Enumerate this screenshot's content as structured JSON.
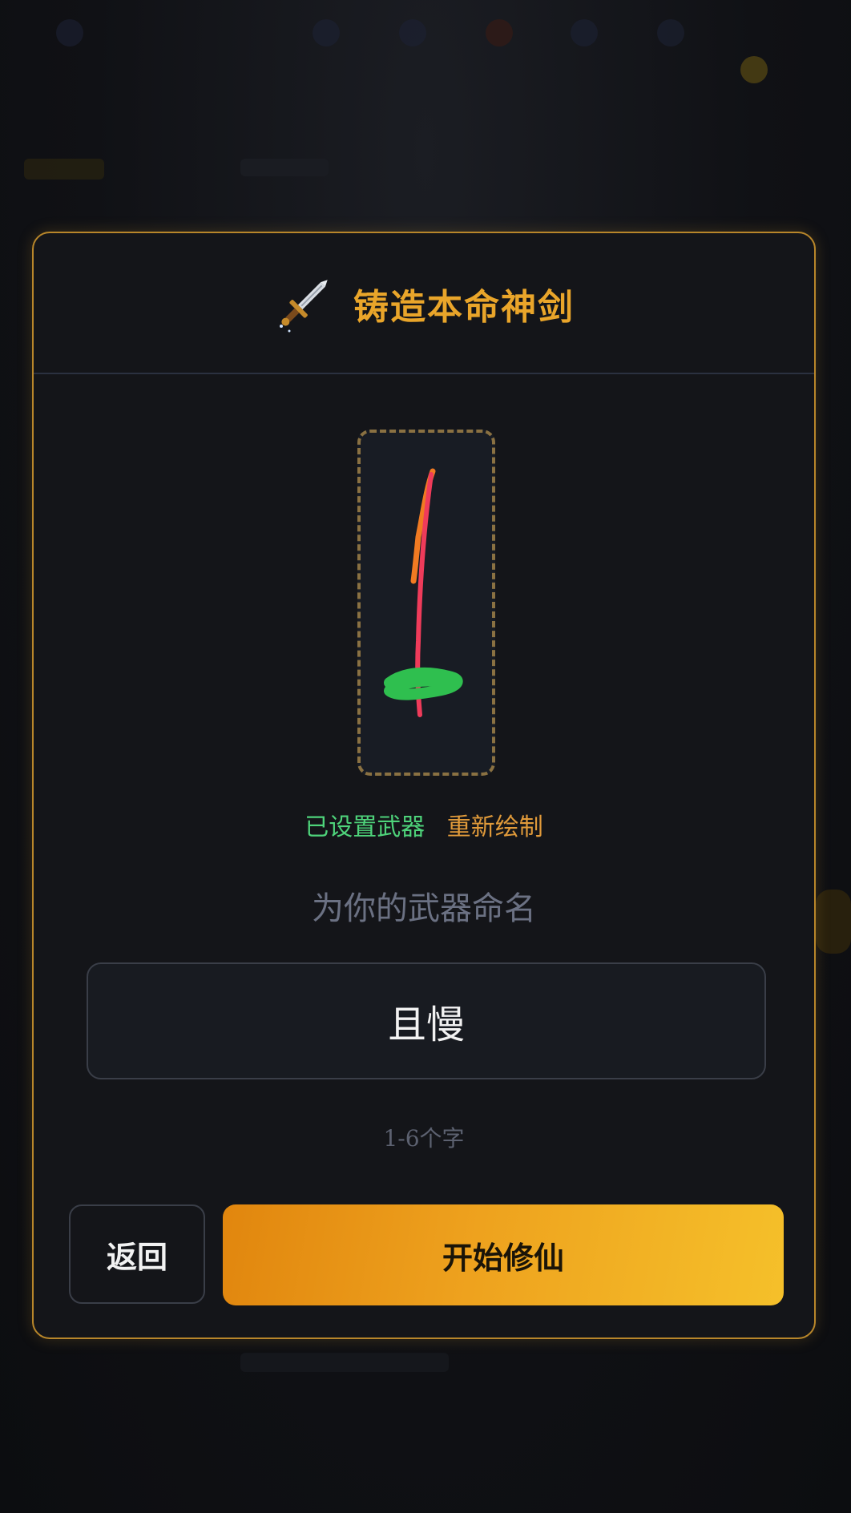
{
  "dialog": {
    "icon": "dagger-icon",
    "title": "铸造本命神剑",
    "title_color": "#e9a52a"
  },
  "drawing": {
    "stroke_colors": [
      "#f07a22",
      "#ef3b5a",
      "#2fbf4f"
    ]
  },
  "status": {
    "set_label": "已设置武器",
    "redraw_label": "重新绘制"
  },
  "name_prompt": "为你的武器命名",
  "name_input": {
    "value": "且慢"
  },
  "hint": "1-6个字",
  "buttons": {
    "back_label": "返回",
    "start_label": "开始修仙"
  }
}
